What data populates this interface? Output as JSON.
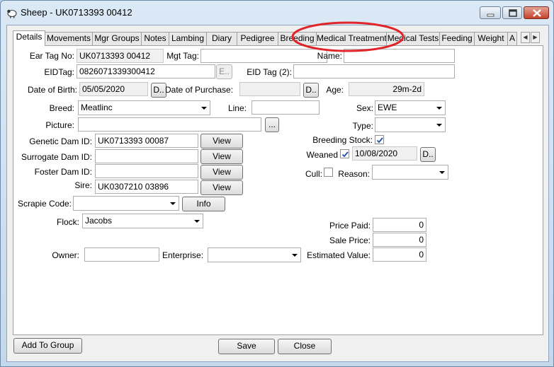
{
  "window": {
    "title": "Sheep - UK0713393 00412",
    "icon": "sheep-icon",
    "controls": [
      "minimize-icon",
      "maximize-icon",
      "close-icon"
    ],
    "annotation_color": "#e0242a"
  },
  "tabs": [
    {
      "label": "Details",
      "active": true
    },
    {
      "label": "Movements"
    },
    {
      "label": "Mgr Groups"
    },
    {
      "label": "Notes"
    },
    {
      "label": "Lambing"
    },
    {
      "label": "Diary"
    },
    {
      "label": "Pedigree"
    },
    {
      "label": "Breeding"
    },
    {
      "label": "Medical Treatment",
      "highlighted": true
    },
    {
      "label": "Medical Tests"
    },
    {
      "label": "Feeding"
    },
    {
      "label": "Weight"
    },
    {
      "label": "A"
    }
  ],
  "form": {
    "ear_tag": {
      "label": "Ear Tag No:",
      "value": "UK0713393 00412"
    },
    "mgt_tag": {
      "label": "Mgt Tag:",
      "value": ""
    },
    "name": {
      "label": "Name:",
      "value": ""
    },
    "eid_tag": {
      "label": "EIDTag:",
      "value": "0826071339300412",
      "button": "E.."
    },
    "eid_tag2": {
      "label": "EID Tag (2):",
      "value": ""
    },
    "dob": {
      "label": "Date of Birth:",
      "value": "05/05/2020",
      "button": "D.."
    },
    "purchase_date": {
      "label": "Date of Purchase:",
      "value": "",
      "button": "D.."
    },
    "age": {
      "label": "Age:",
      "value": "29m-2d"
    },
    "breed": {
      "label": "Breed:",
      "value": "Meatlinc"
    },
    "line": {
      "label": "Line:",
      "value": ""
    },
    "sex": {
      "label": "Sex:",
      "value": "EWE"
    },
    "picture": {
      "label": "Picture:",
      "value": "",
      "button": "..."
    },
    "type": {
      "label": "Type:",
      "value": ""
    },
    "genetic_dam": {
      "label": "Genetic Dam ID:",
      "value": "UK0713393 00087",
      "button": "View"
    },
    "surrogate_dam": {
      "label": "Surrogate Dam ID:",
      "value": "",
      "button": "View"
    },
    "foster_dam": {
      "label": "Foster Dam ID:",
      "value": "",
      "button": "View"
    },
    "sire": {
      "label": "Sire:",
      "value": "UK0307210 03896",
      "button": "View"
    },
    "breeding_stock": {
      "label": "Breeding Stock:",
      "checked": true
    },
    "weaned": {
      "label": "Weaned",
      "checked": true,
      "date": "10/08/2020",
      "button": "D.."
    },
    "cull": {
      "label": "Cull:",
      "checked": false
    },
    "reason": {
      "label": "Reason:",
      "value": ""
    },
    "scrapie": {
      "label": "Scrapie Code:",
      "value": "",
      "button": "Info"
    },
    "flock": {
      "label": "Flock:",
      "value": "Jacobs"
    },
    "price_paid": {
      "label": "Price Paid:",
      "value": "0"
    },
    "sale_price": {
      "label": "Sale Price:",
      "value": "0"
    },
    "owner": {
      "label": "Owner:",
      "value": ""
    },
    "enterprise": {
      "label": "Enterprise:",
      "value": ""
    },
    "estimated_value": {
      "label": "Estimated Value:",
      "value": "0"
    }
  },
  "footer": {
    "add_to_group": "Add To Group",
    "save": "Save",
    "close": "Close"
  }
}
